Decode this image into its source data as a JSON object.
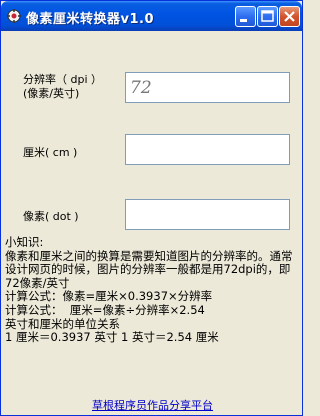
{
  "window": {
    "title": "像素厘米转换器v1.0",
    "accent": "#0054E3"
  },
  "form": {
    "dpi_label_line1": "分辨率（ dpi ）",
    "dpi_label_line2": "(像素/英寸)",
    "dpi_value": "72",
    "cm_label": "厘米( cm )",
    "cm_value": "",
    "dot_label": "像素( dot )",
    "dot_value": ""
  },
  "info": {
    "heading": "小知识:",
    "paragraph": "像素和厘米之间的换算是需要知道图片的分辨率的。通常设计网页的时候，图片的分辨率一般都是用72dpi的，即72像素/英寸",
    "formula1": "计算公式：像素=厘米×0.3937×分辨率",
    "formula2": "计算公式：  厘米=像素÷分辨率×2.54",
    "units_heading": "英寸和厘米的单位关系",
    "units": "1 厘米＝0.3937 英寸 1 英寸＝2.54 厘米"
  },
  "footer": {
    "link_text": "草根程序员作品分享平台"
  }
}
